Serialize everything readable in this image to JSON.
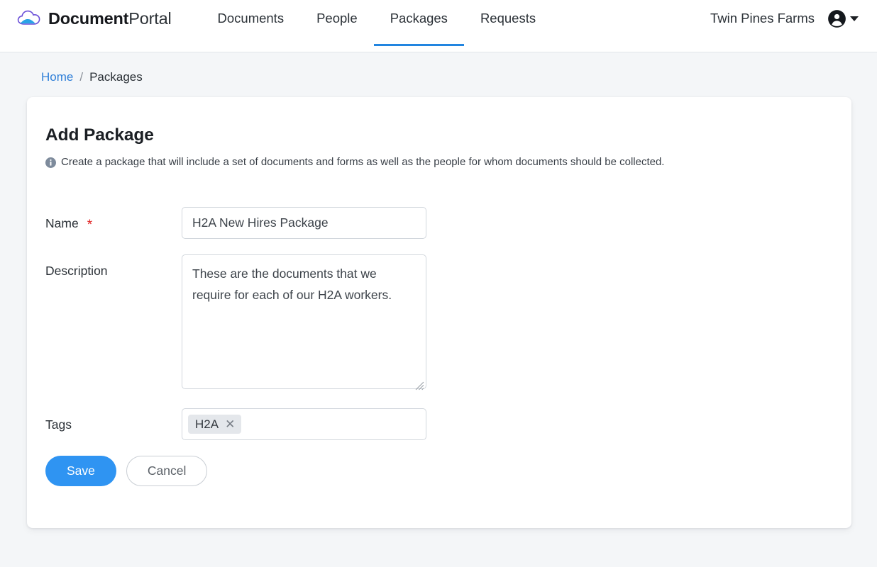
{
  "brand": {
    "name_bold": "Document",
    "name_light": "Portal",
    "logo_icon": "cloud-icon"
  },
  "nav": {
    "items": [
      {
        "label": "Documents",
        "active": false
      },
      {
        "label": "People",
        "active": false
      },
      {
        "label": "Packages",
        "active": true
      },
      {
        "label": "Requests",
        "active": false
      }
    ]
  },
  "topright": {
    "org_name": "Twin Pines Farms",
    "account_icon": "account-circle-icon",
    "caret_icon": "chevron-down-icon"
  },
  "breadcrumb": {
    "home_label": "Home",
    "separator": "/",
    "current_label": "Packages"
  },
  "card": {
    "title": "Add Package",
    "info_icon": "info-circle-icon",
    "subtitle": "Create a package that will include a set of documents and forms as well as the people for whom documents should be collected."
  },
  "form": {
    "name": {
      "label": "Name",
      "required_marker": "*",
      "value": "H2A New Hires Package",
      "placeholder": ""
    },
    "description": {
      "label": "Description",
      "value": "These are the documents that we require for each of our H2A workers.",
      "placeholder": ""
    },
    "tags": {
      "label": "Tags",
      "chips": [
        {
          "label": "H2A",
          "remove_icon": "close-icon"
        }
      ],
      "placeholder": ""
    }
  },
  "actions": {
    "save_label": "Save",
    "cancel_label": "Cancel"
  },
  "colors": {
    "accent_blue": "#2285e0",
    "primary_button": "#2f94f2",
    "link_blue": "#2f7fd8",
    "required_red": "#e02020",
    "page_background": "#f4f6f8",
    "card_background": "#ffffff",
    "tag_chip_background": "#e4e7eb"
  }
}
